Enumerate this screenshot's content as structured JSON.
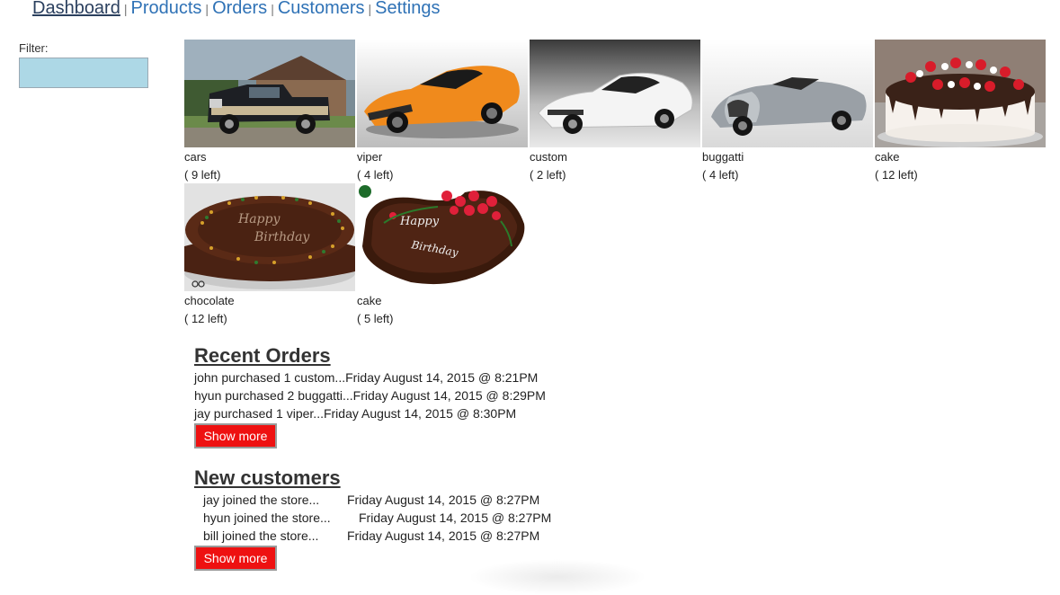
{
  "nav": {
    "items": [
      "Dashboard",
      "Products",
      "Orders",
      "Customers",
      "Settings"
    ],
    "separator": "|",
    "active": "Dashboard"
  },
  "filter": {
    "label": "Filter:",
    "value": ""
  },
  "products": [
    {
      "name": "cars",
      "stock": "( 9 left)",
      "image": "pickup-truck"
    },
    {
      "name": "viper",
      "stock": "( 4 left)",
      "image": "orange-sports-car"
    },
    {
      "name": "custom",
      "stock": "( 2 left)",
      "image": "white-supercar"
    },
    {
      "name": "buggatti",
      "stock": "( 4 left)",
      "image": "silver-roadster"
    },
    {
      "name": "cake",
      "stock": "( 12 left)",
      "image": "strawberry-cake"
    },
    {
      "name": "chocolate",
      "stock": "( 12 left)",
      "image": "chocolate-birthday-cake"
    },
    {
      "name": "cake",
      "stock": "( 5 left)",
      "image": "heart-birthday-cake"
    }
  ],
  "recent_orders": {
    "title": "Recent Orders",
    "rows": [
      "john purchased 1 custom...Friday August 14, 2015 @ 8:21PM",
      "hyun purchased 2 buggatti...Friday August 14, 2015 @ 8:29PM",
      "jay purchased 1 viper...Friday August 14, 2015 @ 8:30PM"
    ],
    "button": "Show more"
  },
  "new_customers": {
    "title": "New customers",
    "rows": [
      {
        "text": "jay joined the store...",
        "date": "Friday August 14, 2015 @ 8:27PM"
      },
      {
        "text": "hyun joined the store...",
        "date": "Friday August 14, 2015 @ 8:27PM"
      },
      {
        "text": "bill joined the store...",
        "date": "Friday August 14, 2015 @ 8:27PM"
      }
    ],
    "button": "Show more"
  },
  "colors": {
    "link": "#2f72b6",
    "active_link": "#2a3f5e",
    "filter_bg": "#add8e6",
    "button_bg": "#ee1111"
  },
  "image_text": {
    "heart_cake_line1": "Happy",
    "heart_cake_line2": "Birthday",
    "chocolate_cake_line1": "Happy",
    "chocolate_cake_line2": "Birthday"
  }
}
